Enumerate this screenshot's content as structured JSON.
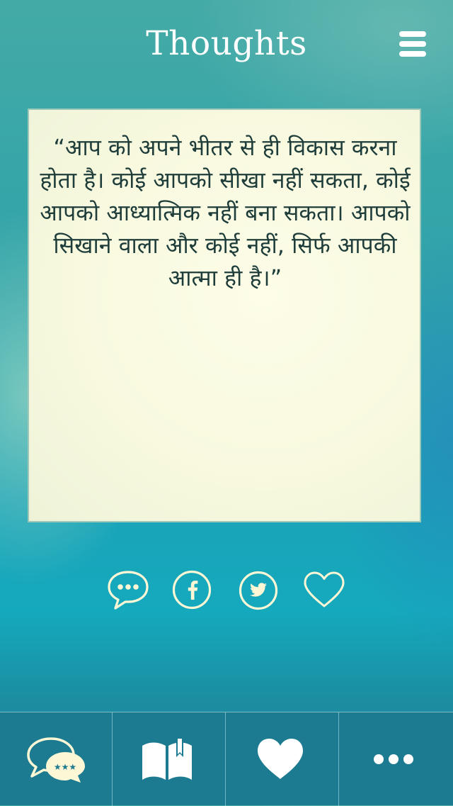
{
  "header": {
    "title": "Thoughts",
    "menu_icon": "hamburger-menu-icon"
  },
  "quote": {
    "text": "“आप को अपने भीतर से ही विकास करना होता है। कोई आपको सीखा नहीं सकता, कोई आपको आध्यात्मिक नहीं बना सकता। आपको सिखाने वाला और कोई नहीं, सिर्फ आपकी आत्मा ही है।”"
  },
  "share": {
    "icons": [
      "message-bubble-icon",
      "facebook-icon",
      "twitter-icon",
      "heart-outline-icon"
    ]
  },
  "tabbar": {
    "tabs": [
      {
        "icon": "chat-bubbles-stars-icon"
      },
      {
        "icon": "open-book-icon"
      },
      {
        "icon": "heart-filled-icon"
      },
      {
        "icon": "more-dots-icon"
      }
    ]
  },
  "colors": {
    "card_background": "#f8f9df",
    "quote_text": "#1e3d3a",
    "tabbar_background": "#1c7b90",
    "icon_light": "#fdf7d6",
    "icon_white": "#ffffff"
  }
}
